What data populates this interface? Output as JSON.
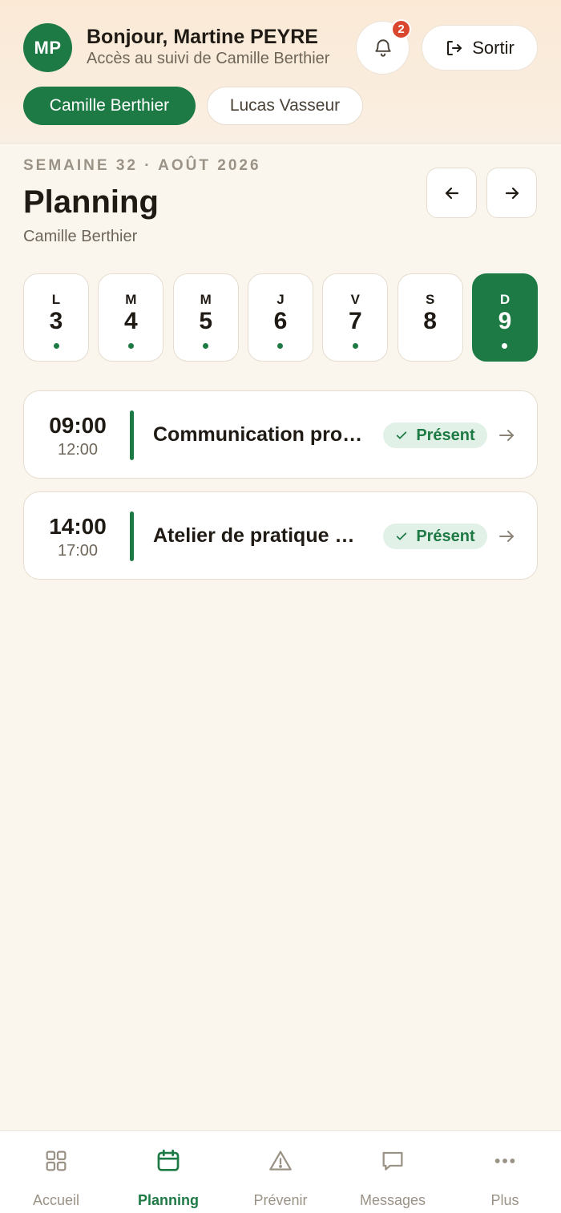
{
  "header": {
    "avatar_initials": "MP",
    "greeting": "Bonjour, Martine PEYRE",
    "subtitle": "Accès au suivi de Camille Berthier",
    "notification_count": "2",
    "logout_label": "Sortir",
    "children": [
      {
        "name": "Camille Berthier",
        "active": true
      },
      {
        "name": "Lucas Vasseur",
        "active": false
      }
    ]
  },
  "week": {
    "label": "SEMAINE 32 · AOÛT 2026",
    "title": "Planning",
    "student": "Camille Berthier",
    "days": [
      {
        "letter": "L",
        "num": "3",
        "has_event": true,
        "selected": false
      },
      {
        "letter": "M",
        "num": "4",
        "has_event": true,
        "selected": false
      },
      {
        "letter": "M",
        "num": "5",
        "has_event": true,
        "selected": false
      },
      {
        "letter": "J",
        "num": "6",
        "has_event": true,
        "selected": false
      },
      {
        "letter": "V",
        "num": "7",
        "has_event": true,
        "selected": false
      },
      {
        "letter": "S",
        "num": "8",
        "has_event": false,
        "selected": false
      },
      {
        "letter": "D",
        "num": "9",
        "has_event": true,
        "selected": true
      }
    ]
  },
  "sessions": [
    {
      "start": "09:00",
      "end": "12:00",
      "title": "Communication professionnelle",
      "status": "Présent"
    },
    {
      "start": "14:00",
      "end": "17:00",
      "title": "Atelier de pratique professionnelle",
      "status": "Présent"
    }
  ],
  "nav": {
    "tabs": [
      {
        "label": "Accueil",
        "icon": "grid-icon",
        "active": false
      },
      {
        "label": "Planning",
        "icon": "calendar-icon",
        "active": true
      },
      {
        "label": "Prévenir",
        "icon": "warning-icon",
        "active": false
      },
      {
        "label": "Messages",
        "icon": "message-icon",
        "active": false
      },
      {
        "label": "Plus",
        "icon": "more-icon",
        "active": false
      }
    ]
  },
  "colors": {
    "accent": "#1e7a45",
    "badge": "#d9472f",
    "status_bg": "#e2f1e7"
  }
}
